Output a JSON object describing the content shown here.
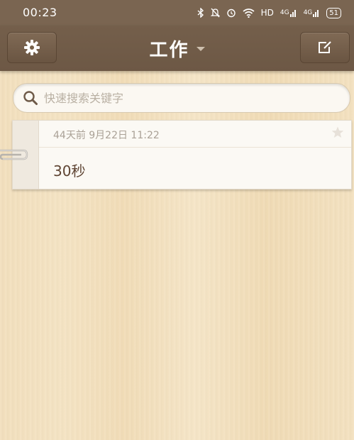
{
  "status_bar": {
    "time": "00:23",
    "network_1": "HD",
    "signal_1": "4G",
    "signal_2": "4G",
    "battery": "51"
  },
  "header": {
    "title": "工作",
    "settings_icon": "gear-icon",
    "compose_icon": "edit-note-icon"
  },
  "search": {
    "placeholder": "快速搜索关键字"
  },
  "notes": [
    {
      "meta": "44天前 9月22日 11:22",
      "text": "30秒"
    }
  ],
  "colors": {
    "header_bg": "#725d49",
    "paper_bg": "#f3e1c0",
    "note_text": "#5f4533",
    "meta_text": "#aaa196"
  }
}
